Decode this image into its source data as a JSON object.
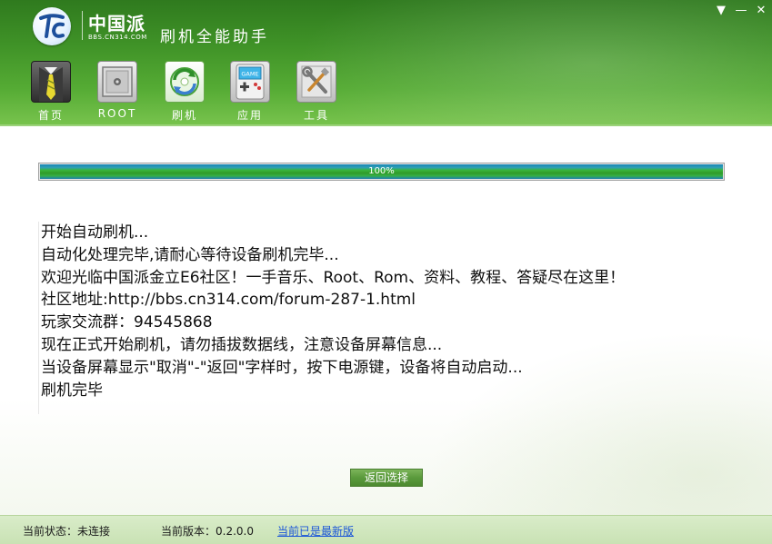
{
  "window": {
    "brand": "中国派",
    "brand_sub": "BBS.CN314.COM",
    "title": "刷机全能助手",
    "menu_glyph": "▼",
    "min_glyph": "—",
    "close_glyph": "✕"
  },
  "nav": {
    "items": [
      {
        "label": "首页",
        "icon": "tie-icon"
      },
      {
        "label": "ROOT",
        "icon": "safe-icon"
      },
      {
        "label": "刷机",
        "icon": "refresh-disc-icon"
      },
      {
        "label": "应用",
        "icon": "game-console-icon"
      },
      {
        "label": "工具",
        "icon": "tools-icon"
      }
    ],
    "active": "刷机"
  },
  "progress": {
    "value": 1.0,
    "label": "100%"
  },
  "log": {
    "lines": [
      "开始自动刷机...",
      "自动化处理完毕,请耐心等待设备刷机完毕...",
      "欢迎光临中国派金立E6社区！一手音乐、Root、Rom、资料、教程、答疑尽在这里！",
      "社区地址:http://bbs.cn314.com/forum-287-1.html",
      "玩家交流群：94545868",
      "现在正式开始刷机，请勿插拔数据线，注意设备屏幕信息...",
      "当设备屏幕显示\"取消\"-\"返回\"字样时，按下电源键，设备将自动启动...",
      "刷机完毕"
    ]
  },
  "actions": {
    "back_label": "返回选择"
  },
  "status": {
    "state": "当前状态：未连接",
    "version": "当前版本：0.2.0.0",
    "update": "当前已是最新版"
  },
  "colors": {
    "header_green": "#3f9227",
    "progress_green": "#2f9a2a",
    "progress_blue": "#1a86b8",
    "link_blue": "#1a55d8",
    "button_green": "#5a9a3c"
  }
}
